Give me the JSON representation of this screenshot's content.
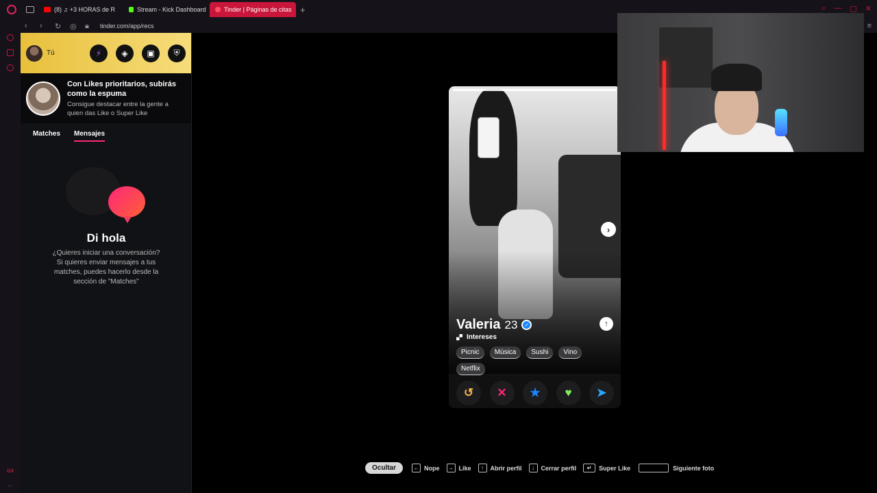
{
  "browser": {
    "tabs": [
      {
        "label": "(8) ♫ +3 HORAS de R",
        "favicon_color": "#ff0000",
        "active": false
      },
      {
        "label": "Stream - Kick Dashboard",
        "favicon_color": "#53fc18",
        "active": false
      },
      {
        "label": "Tinder | Páginas de citas",
        "favicon_color": "#fd5068",
        "active": true
      }
    ],
    "new_tab": "+",
    "url": "tinder.com/app/recs",
    "gx_label": "GX",
    "more_label": "..."
  },
  "sidebar": {
    "you_label": "Tú",
    "header_icons": [
      "bolt-icon",
      "compass-icon",
      "briefcase-icon",
      "shield-icon"
    ],
    "promo": {
      "title": "Con Likes prioritarios, subirás como la espuma",
      "subtitle": "Consigue destacar entre la gente a quien das Like o Super Like"
    },
    "tabs": [
      "Matches",
      "Mensajes"
    ],
    "selected_tab": "Mensajes",
    "empty_state": {
      "title": "Di hola",
      "body": "¿Quieres iniciar una conversación? Si quieres enviar mensajes a tus matches, puedes hacerlo desde la sección de \"Matches\""
    }
  },
  "profile": {
    "name": "Valeria",
    "age": "23",
    "verified": true,
    "interests_label": "Intereses",
    "interests": [
      "Picnic",
      "Música",
      "Sushi",
      "Vino",
      "Netflix"
    ],
    "next_photo_glyph": "›",
    "info_glyph": "↑"
  },
  "actions": {
    "rewind": "↺",
    "nope": "✕",
    "super_like": "★",
    "like": "♥",
    "boost": "➤"
  },
  "shortcuts": {
    "hide": "Ocultar",
    "items": [
      {
        "key": "←",
        "label": "Nope"
      },
      {
        "key": "→",
        "label": "Like"
      },
      {
        "key": "↑",
        "label": "Abrir perfil"
      },
      {
        "key": "↓",
        "label": "Cerrar perfil"
      },
      {
        "key": "↵",
        "label": "Super Like"
      },
      {
        "key": "",
        "label": "Siguiente foto"
      }
    ]
  },
  "colors": {
    "brand_pink": "#fd267a",
    "tab_active": "#c9163a",
    "gold": "#e8c03c"
  }
}
